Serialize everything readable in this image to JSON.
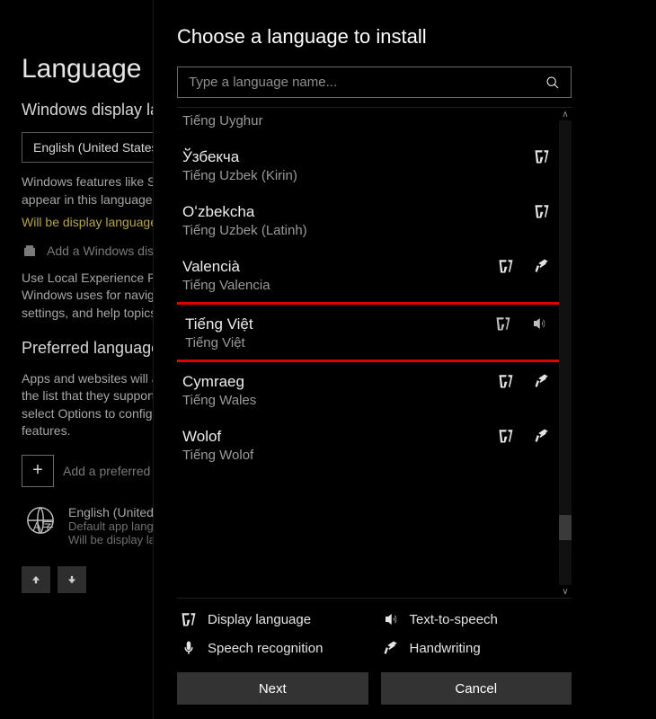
{
  "background": {
    "heading": "Language",
    "section_display": "Windows display language",
    "current_display_language": "English (United States)",
    "display_desc_line": "Windows features like Settings and File Explorer will appear in this language.",
    "display_warn": "Will be display language after next sign-in",
    "add_pack_label": "Add a Windows display language",
    "lep_desc": "Use Local Experience Packs to change the language Windows uses for navigation, menus, messages, settings, and help topics.",
    "section_preferred": "Preferred languages",
    "preferred_desc": "Apps and websites will appear in the first language in the list that they support. Select a language and then select Options to configure keyboards and other features.",
    "add_preferred_label": "Add a preferred language",
    "english_card_title": "English (United States)",
    "english_card_sub1": "Default app language; Default input language",
    "english_card_sub2": "Will be display language after next sign-in"
  },
  "dialog": {
    "title": "Choose a language to install",
    "search_placeholder": "Type a language name...",
    "list": [
      {
        "name1": "",
        "name2": "Tiếng Uyghur",
        "icons": [],
        "partial": true,
        "highlight": false
      },
      {
        "name1": "Ўзбекча",
        "name2": "Tiếng Uzbek (Kirin)",
        "icons": [
          "display"
        ],
        "partial": false,
        "highlight": false
      },
      {
        "name1": "Oʻzbekcha",
        "name2": "Tiếng Uzbek (Latinh)",
        "icons": [
          "display"
        ],
        "partial": false,
        "highlight": false
      },
      {
        "name1": "Valencià",
        "name2": "Tiếng Valencia",
        "icons": [
          "display",
          "handwriting"
        ],
        "partial": false,
        "highlight": false
      },
      {
        "name1": "Tiếng Việt",
        "name2": "Tiếng Việt",
        "icons": [
          "display",
          "tts"
        ],
        "partial": false,
        "highlight": true
      },
      {
        "name1": "Cymraeg",
        "name2": "Tiếng Wales",
        "icons": [
          "display",
          "handwriting"
        ],
        "partial": false,
        "highlight": false
      },
      {
        "name1": "Wolof",
        "name2": "Tiếng Wolof",
        "icons": [
          "display",
          "handwriting"
        ],
        "partial": false,
        "highlight": false
      }
    ],
    "legend": {
      "display": "Display language",
      "tts": "Text-to-speech",
      "speech": "Speech recognition",
      "handwriting": "Handwriting"
    },
    "buttons": {
      "next": "Next",
      "cancel": "Cancel"
    }
  }
}
